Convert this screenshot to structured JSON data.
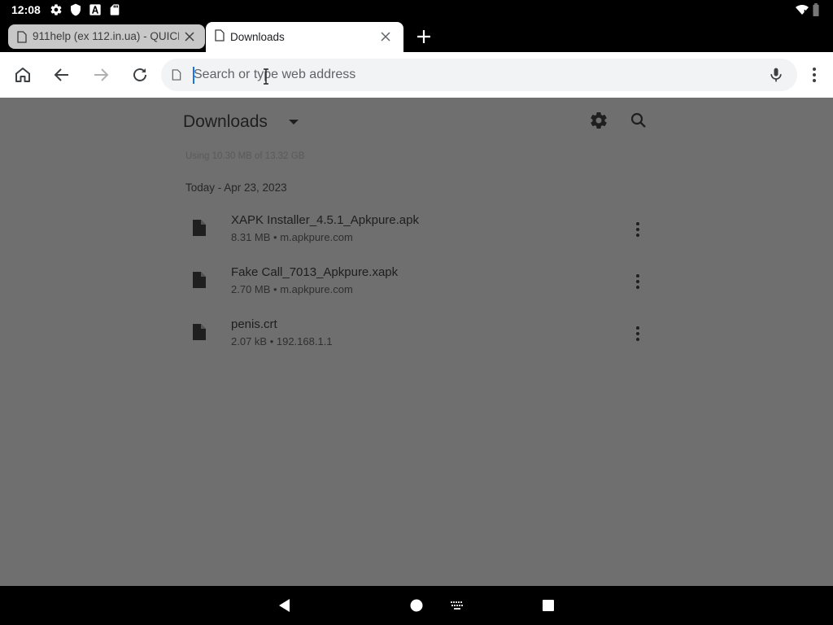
{
  "status_bar": {
    "time": "12:08",
    "icons": [
      "settings-icon",
      "shield-icon",
      "font-a-icon",
      "sd-card-icon",
      "wifi-icon",
      "battery-icon"
    ]
  },
  "tabs": [
    {
      "title": "911help (ex 112.in.ua) - QUICK",
      "active": false
    },
    {
      "title": "Downloads",
      "active": true
    }
  ],
  "toolbar": {
    "address_placeholder": "Search or type web address",
    "address_value": ""
  },
  "downloads": {
    "title": "Downloads",
    "storage": "Using 10.30 MB of 13.32 GB",
    "date_group": "Today - Apr 23, 2023",
    "items": [
      {
        "name": "XAPK Installer_4.5.1_Apkpure.apk",
        "meta": "8.31 MB • m.apkpure.com"
      },
      {
        "name": "Fake Call_7013_Apkpure.xapk",
        "meta": "2.70 MB • m.apkpure.com"
      },
      {
        "name": "penis.crt",
        "meta": "2.07 kB • 192.168.1.1"
      }
    ]
  },
  "colors": {
    "overlay": "#6f6f6f",
    "accent": "#1a73e8",
    "toolbar": "#ffffff",
    "system_bars": "#000000"
  }
}
